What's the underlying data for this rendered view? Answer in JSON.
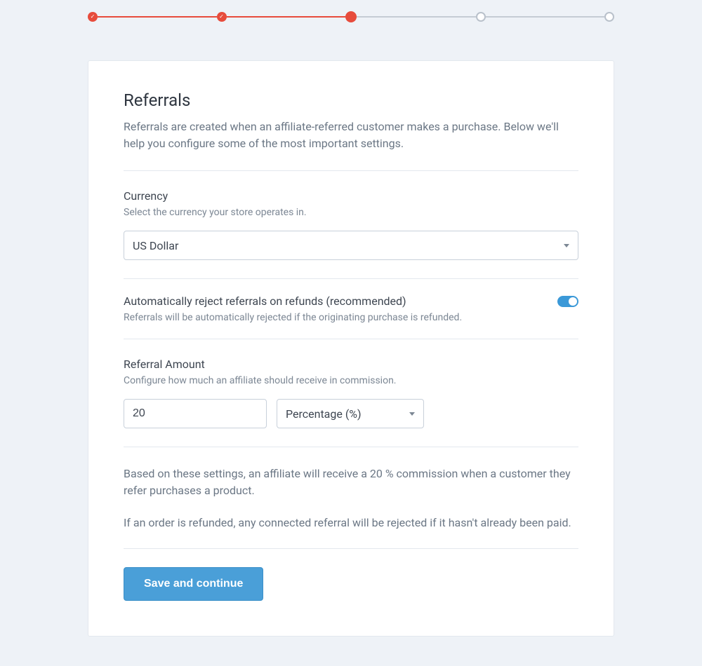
{
  "stepper": {
    "steps": [
      {
        "state": "completed"
      },
      {
        "state": "completed"
      },
      {
        "state": "current"
      },
      {
        "state": "pending"
      },
      {
        "state": "pending"
      }
    ]
  },
  "page": {
    "title": "Referrals",
    "subtitle": "Referrals are created when an affiliate-referred customer makes a purchase. Below we'll help you configure some of the most important settings."
  },
  "currency": {
    "label": "Currency",
    "help": "Select the currency your store operates in.",
    "value": "US Dollar"
  },
  "autoReject": {
    "label": "Automatically reject referrals on refunds (recommended)",
    "help": "Referrals will be automatically rejected if the originating purchase is refunded.",
    "enabled": true
  },
  "amount": {
    "label": "Referral Amount",
    "help": "Configure how much an affiliate should receive in commission.",
    "value": "20",
    "typeValue": "Percentage (%)"
  },
  "summary": {
    "line1": "Based on these settings, an affiliate will receive a 20 % commission when a customer they refer purchases a product.",
    "line2": "If an order is refunded, any connected referral will be rejected if it hasn't already been paid."
  },
  "actions": {
    "save": "Save and continue"
  }
}
